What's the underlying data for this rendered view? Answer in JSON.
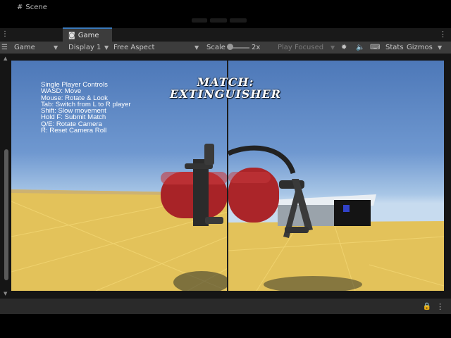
{
  "tabs": {
    "scene": "Scene",
    "game": "Game"
  },
  "toolbar": {
    "mode": "Game",
    "display": "Display 1",
    "aspect": "Free Aspect",
    "scale_label": "Scale",
    "scale_value": "2x",
    "play_focused": "Play Focused",
    "stats": "Stats",
    "gizmos": "Gizmos"
  },
  "game": {
    "controls": [
      "Single Player Controls",
      "WASD: Move",
      "Mouse: Rotate & Look",
      "Tab: Switch from L to R player",
      "Shift: Slow movement",
      "Hold F: Submit Match",
      "Q/E: Rotate Camera",
      "R: Reset Camera Roll"
    ],
    "match_line1": "MATCH:",
    "match_line2": "EXTINGUISHER"
  },
  "colors": {
    "accent": "#3a79bb",
    "sky_top": "#4d78b8",
    "ground": "#e3c25a",
    "extinguisher": "#b3262a"
  }
}
